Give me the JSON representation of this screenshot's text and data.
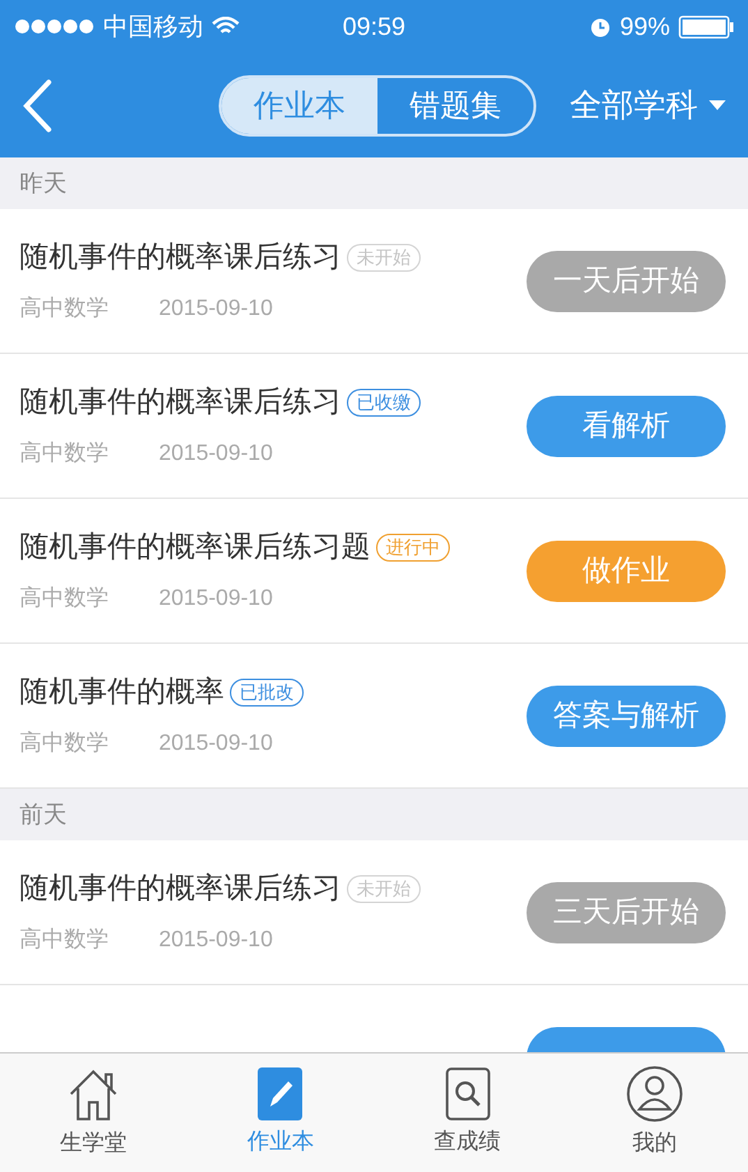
{
  "status_bar": {
    "carrier": "中国移动",
    "time": "09:59",
    "battery": "99%"
  },
  "nav": {
    "tabs": [
      {
        "label": "作业本",
        "selected": true
      },
      {
        "label": "错题集",
        "selected": false
      }
    ],
    "filter": "全部学科"
  },
  "sections": [
    {
      "title": "昨天",
      "items": [
        {
          "title": "随机事件的概率课后练习",
          "status": {
            "label": "未开始",
            "kind": "pending"
          },
          "subject": "高中数学",
          "date": "2015-09-10",
          "action": {
            "label": "一天后开始",
            "kind": "disabled"
          }
        },
        {
          "title": "随机事件的概率课后练习",
          "status": {
            "label": "已收缴",
            "kind": "info"
          },
          "subject": "高中数学",
          "date": "2015-09-10",
          "action": {
            "label": "看解析",
            "kind": "primary"
          }
        },
        {
          "title": "随机事件的概率课后练习题",
          "status": {
            "label": "进行中",
            "kind": "active"
          },
          "subject": "高中数学",
          "date": "2015-09-10",
          "action": {
            "label": "做作业",
            "kind": "warning"
          }
        },
        {
          "title": "随机事件的概率",
          "status": {
            "label": "已批改",
            "kind": "info"
          },
          "subject": "高中数学",
          "date": "2015-09-10",
          "action": {
            "label": "答案与解析",
            "kind": "primary"
          }
        }
      ]
    },
    {
      "title": "前天",
      "items": [
        {
          "title": "随机事件的概率课后练习",
          "status": {
            "label": "未开始",
            "kind": "pending"
          },
          "subject": "高中数学",
          "date": "2015-09-10",
          "action": {
            "label": "三天后开始",
            "kind": "disabled"
          }
        },
        {
          "action": {
            "kind": "primary"
          }
        }
      ]
    }
  ],
  "tab_bar": [
    {
      "label": "生学堂",
      "kind": "home",
      "selected": false
    },
    {
      "label": "作业本",
      "kind": "homework",
      "selected": true
    },
    {
      "label": "查成绩",
      "kind": "search",
      "selected": false
    },
    {
      "label": "我的",
      "kind": "profile",
      "selected": false
    }
  ]
}
